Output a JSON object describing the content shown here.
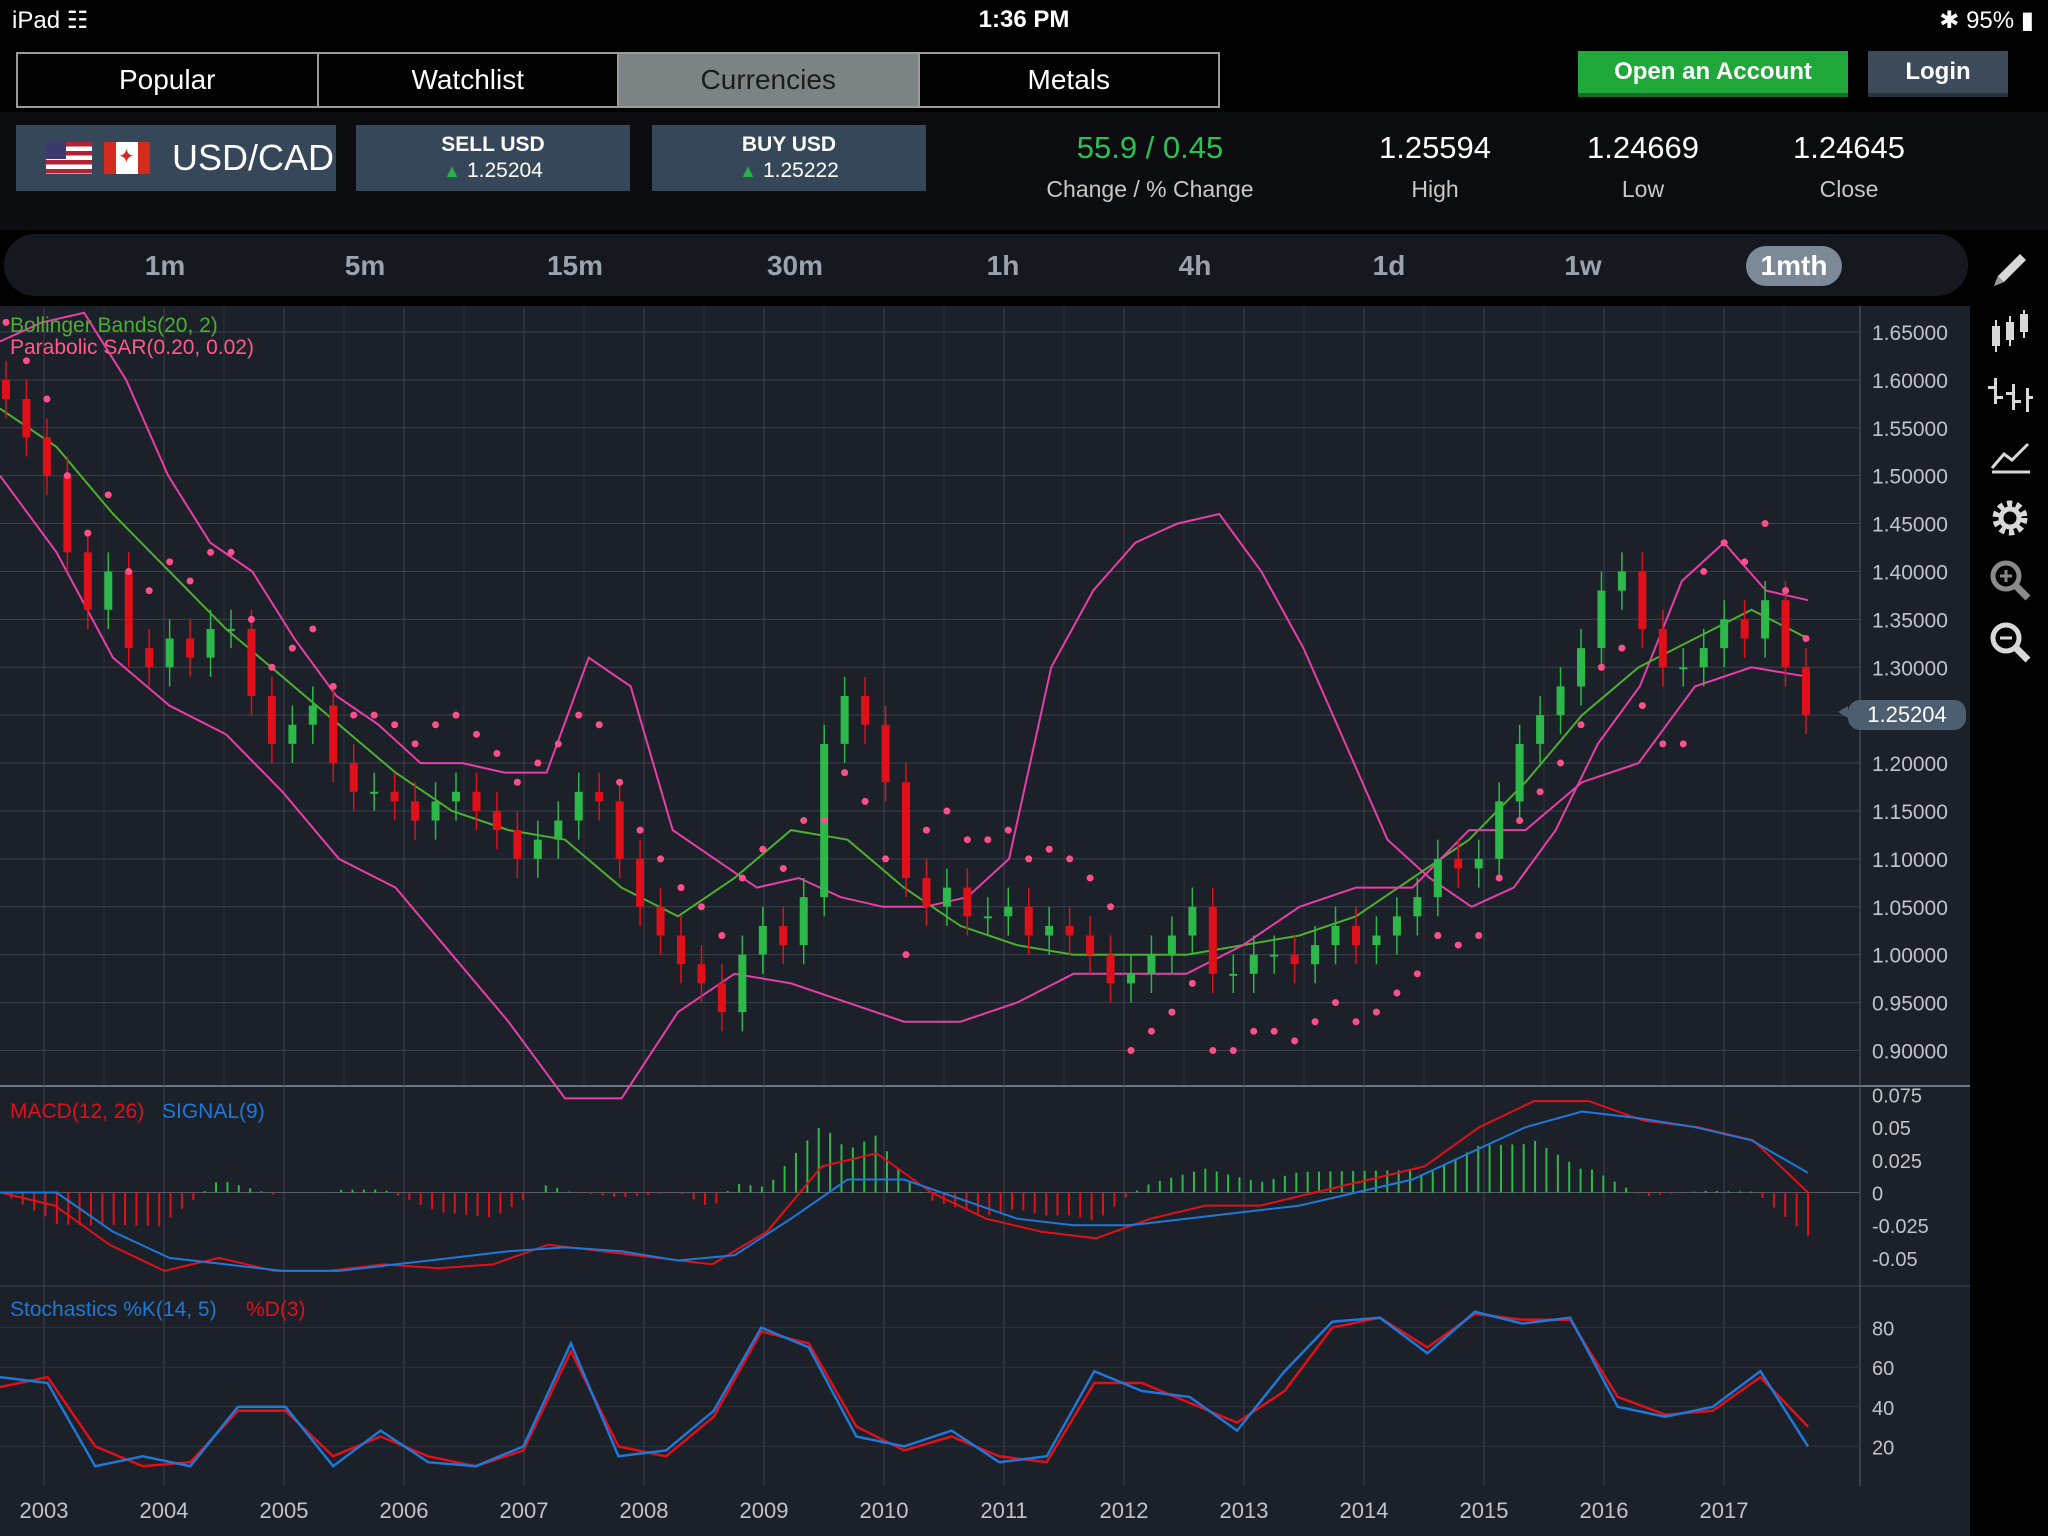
{
  "status_bar": {
    "device": "iPad",
    "time": "1:36 PM",
    "battery": "95%"
  },
  "nav_tabs": [
    {
      "label": "Popular",
      "active": false
    },
    {
      "label": "Watchlist",
      "active": false
    },
    {
      "label": "Currencies",
      "active": true
    },
    {
      "label": "Metals",
      "active": false
    }
  ],
  "header_buttons": {
    "open_account": "Open an Account",
    "login": "Login"
  },
  "instrument": {
    "symbol": "USD/CAD",
    "flags": [
      "us-flag-icon",
      "canada-flag-icon"
    ]
  },
  "trade": {
    "sell_label": "SELL USD",
    "sell_price": "1.25204",
    "buy_label": "BUY USD",
    "buy_price": "1.25222"
  },
  "stats": {
    "change_value": "55.9 / 0.45",
    "change_label": "Change / % Change",
    "high_value": "1.25594",
    "high_label": "High",
    "low_value": "1.24669",
    "low_label": "Low",
    "close_value": "1.24645",
    "close_label": "Close"
  },
  "timeframes": [
    {
      "label": "1m",
      "active": false
    },
    {
      "label": "5m",
      "active": false
    },
    {
      "label": "15m",
      "active": false
    },
    {
      "label": "30m",
      "active": false
    },
    {
      "label": "1h",
      "active": false
    },
    {
      "label": "4h",
      "active": false
    },
    {
      "label": "1d",
      "active": false
    },
    {
      "label": "1w",
      "active": false
    },
    {
      "label": "1mth",
      "active": true
    }
  ],
  "tools": [
    "pencil-icon",
    "candlestick-icon",
    "ohlc-bars-icon",
    "line-chart-icon",
    "gear-icon",
    "zoom-in-icon",
    "zoom-out-icon"
  ],
  "current_price": "1.25204",
  "colors": {
    "up": "#2db84a",
    "down": "#e0101a",
    "bollinger_bands": "#e83ea8",
    "bollinger_mid": "#4caf2f",
    "sar": "#ff4f8a",
    "macd": "#e0101a",
    "signal": "#1e78d8",
    "stoch_k": "#1e78d8",
    "stoch_d": "#e0101a"
  },
  "chart_data": [
    {
      "type": "candlestick",
      "title": "",
      "indicators": [
        "Bollinger Bands(20, 2)",
        "Parabolic SAR(0.20, 0.02)"
      ],
      "x": [
        "2003",
        "2004",
        "2005",
        "2006",
        "2007",
        "2008",
        "2009",
        "2010",
        "2011",
        "2012",
        "2013",
        "2014",
        "2015",
        "2016",
        "2017"
      ],
      "y_ticks": [
        "1.65000",
        "1.60000",
        "1.55000",
        "1.50000",
        "1.45000",
        "1.40000",
        "1.35000",
        "1.30000",
        "1.25000",
        "1.20000",
        "1.15000",
        "1.10000",
        "1.05000",
        "1.00000",
        "0.95000",
        "0.90000"
      ],
      "ylim": [
        0.865,
        1.675
      ],
      "series": [
        {
          "name": "Close",
          "values": [
            1.58,
            1.54,
            1.5,
            1.42,
            1.36,
            1.4,
            1.32,
            1.3,
            1.33,
            1.31,
            1.34,
            1.34,
            1.27,
            1.22,
            1.24,
            1.26,
            1.2,
            1.17,
            1.17,
            1.16,
            1.14,
            1.16,
            1.17,
            1.15,
            1.13,
            1.1,
            1.12,
            1.14,
            1.17,
            1.16,
            1.1,
            1.05,
            1.02,
            0.99,
            0.97,
            0.94,
            1.0,
            1.03,
            1.01,
            1.06,
            1.22,
            1.27,
            1.24,
            1.18,
            1.08,
            1.05,
            1.07,
            1.04,
            1.04,
            1.05,
            1.02,
            1.03,
            1.02,
            1.0,
            0.97,
            0.98,
            1.0,
            1.02,
            1.05,
            0.98,
            0.98,
            1.0,
            1.0,
            0.99,
            1.01,
            1.03,
            1.01,
            1.02,
            1.04,
            1.06,
            1.1,
            1.09,
            1.1,
            1.16,
            1.22,
            1.25,
            1.28,
            1.32,
            1.38,
            1.4,
            1.34,
            1.3,
            1.3,
            1.32,
            1.35,
            1.33,
            1.37,
            1.3,
            1.25
          ]
        },
        {
          "name": "Bollinger Upper",
          "values": [
            1.64,
            1.66,
            1.67,
            1.6,
            1.5,
            1.43,
            1.4,
            1.33,
            1.27,
            1.24,
            1.2,
            1.2,
            1.19,
            1.19,
            1.31,
            1.28,
            1.13,
            1.1,
            1.07,
            1.08,
            1.06,
            1.05,
            1.05,
            1.06,
            1.1,
            1.3,
            1.38,
            1.43,
            1.45,
            1.46,
            1.4,
            1.32,
            1.22,
            1.12,
            1.08,
            1.05,
            1.07,
            1.13,
            1.22,
            1.28,
            1.39,
            1.43,
            1.38,
            1.37
          ]
        },
        {
          "name": "Bollinger Middle",
          "values": [
            1.57,
            1.53,
            1.46,
            1.4,
            1.34,
            1.29,
            1.24,
            1.19,
            1.15,
            1.13,
            1.12,
            1.07,
            1.04,
            1.08,
            1.13,
            1.12,
            1.07,
            1.03,
            1.01,
            1.0,
            1.0,
            1.0,
            1.01,
            1.02,
            1.04,
            1.08,
            1.12,
            1.18,
            1.25,
            1.3,
            1.33,
            1.36,
            1.33
          ]
        },
        {
          "name": "Bollinger Lower",
          "values": [
            1.5,
            1.42,
            1.31,
            1.26,
            1.23,
            1.17,
            1.1,
            1.07,
            1.0,
            0.93,
            0.85,
            0.85,
            0.94,
            0.98,
            0.97,
            0.95,
            0.93,
            0.93,
            0.95,
            0.98,
            0.98,
            0.98,
            1.01,
            1.05,
            1.07,
            1.07,
            1.13,
            1.13,
            1.18,
            1.2,
            1.28,
            1.3,
            1.29
          ]
        }
      ]
    },
    {
      "type": "line",
      "title": "",
      "indicator": "MACD(12, 26)",
      "signal_label": "SIGNAL(9)",
      "y_ticks": [
        "0.075",
        "0.05",
        "0.025",
        "0",
        "-0.025",
        "-0.05"
      ],
      "ylim": [
        -0.07,
        0.08
      ],
      "series": [
        {
          "name": "MACD(12, 26)",
          "values": [
            0.0,
            -0.01,
            -0.04,
            -0.06,
            -0.05,
            -0.06,
            -0.06,
            -0.055,
            -0.058,
            -0.055,
            -0.04,
            -0.045,
            -0.05,
            -0.055,
            -0.03,
            0.02,
            0.03,
            0.0,
            -0.02,
            -0.03,
            -0.035,
            -0.02,
            -0.01,
            -0.01,
            0.0,
            0.01,
            0.02,
            0.05,
            0.07,
            0.07,
            0.055,
            0.05,
            0.04,
            0.0
          ]
        },
        {
          "name": "SIGNAL(9)",
          "values": [
            0.0,
            0.0,
            -0.03,
            -0.05,
            -0.055,
            -0.06,
            -0.06,
            -0.055,
            -0.05,
            -0.045,
            -0.042,
            -0.045,
            -0.052,
            -0.048,
            -0.02,
            0.01,
            0.01,
            -0.005,
            -0.02,
            -0.025,
            -0.025,
            -0.02,
            -0.015,
            -0.01,
            0.0,
            0.01,
            0.03,
            0.05,
            0.062,
            0.057,
            0.05,
            0.04,
            0.015
          ]
        }
      ]
    },
    {
      "type": "line",
      "title": "",
      "indicator": "Stochastics %K(14, 5)",
      "d_label": "%D(3)",
      "y_ticks": [
        "80",
        "60",
        "40",
        "20"
      ],
      "ylim": [
        0,
        100
      ],
      "series": [
        {
          "name": "%K",
          "values": [
            55,
            52,
            10,
            15,
            10,
            40,
            40,
            10,
            28,
            12,
            10,
            20,
            72,
            15,
            18,
            38,
            80,
            70,
            25,
            20,
            28,
            12,
            15,
            58,
            48,
            45,
            28,
            58,
            83,
            85,
            67,
            88,
            82,
            85,
            40,
            35,
            40,
            58,
            20
          ]
        },
        {
          "name": "%D",
          "values": [
            50,
            55,
            20,
            10,
            12,
            38,
            38,
            15,
            25,
            15,
            10,
            18,
            68,
            20,
            15,
            35,
            78,
            72,
            30,
            18,
            25,
            15,
            12,
            52,
            52,
            42,
            32,
            48,
            80,
            85,
            70,
            87,
            84,
            84,
            45,
            36,
            38,
            55,
            30
          ]
        }
      ]
    }
  ]
}
